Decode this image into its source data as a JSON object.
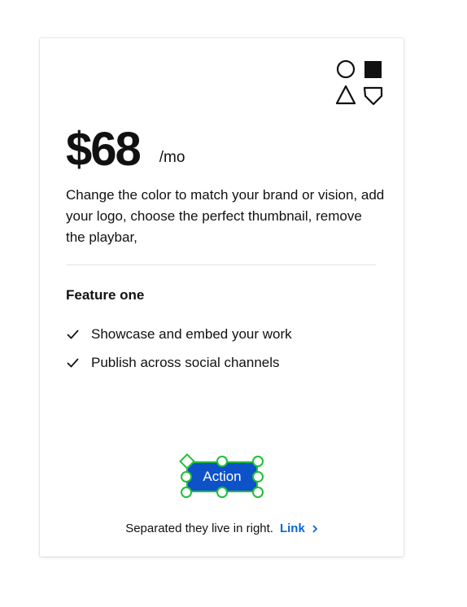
{
  "pricing_card": {
    "price": "$68",
    "period": "/mo",
    "description": "Change the color to match your brand or vision, add your logo, choose the perfect thumbnail, remove the playbar,",
    "feature_title": "Feature one",
    "features": [
      {
        "label": "Showcase and embed your work",
        "icon": "check-icon"
      },
      {
        "label": "Publish across social channels",
        "icon": "check-icon"
      }
    ],
    "action_label": "Action",
    "footer_text": "Separated they live in right.",
    "footer_link": "Link",
    "shapes_icons": [
      "circle-icon",
      "square-icon",
      "triangle-icon",
      "pentagon-icon"
    ]
  },
  "colors": {
    "accent_button": "#0d52c9",
    "selection_outline": "#1fbf3a",
    "link": "#0a66d6"
  }
}
